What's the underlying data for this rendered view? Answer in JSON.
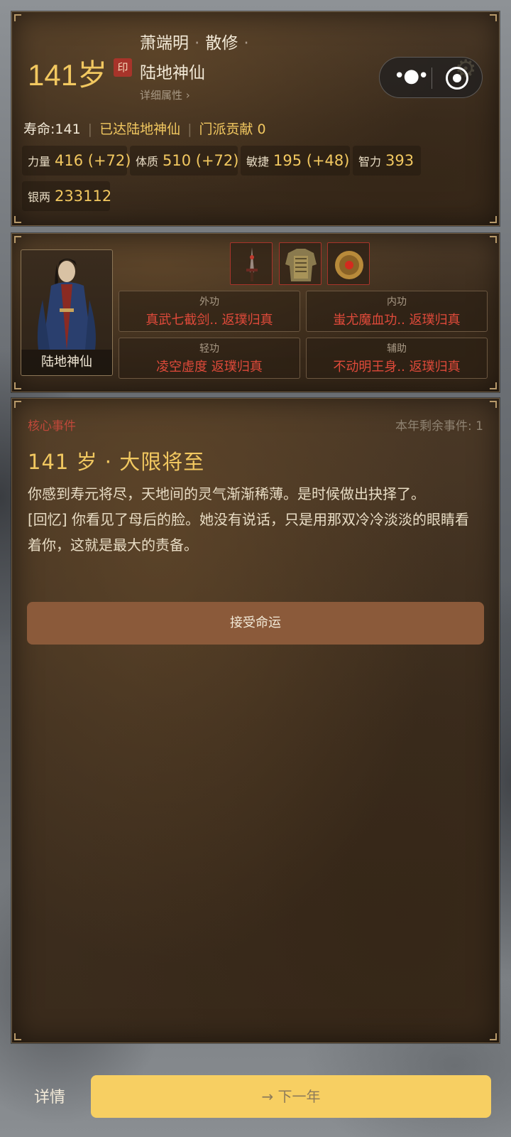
{
  "header": {
    "age": "141岁",
    "seal": "印",
    "name": "萧端明",
    "sect": "散修",
    "realm": "陆地神仙",
    "detail_link": "详细属性 ›"
  },
  "status": {
    "lifespan": "寿命:141",
    "achieved": "已达陆地神仙",
    "contribution": "门派贡献 0"
  },
  "stats": [
    {
      "label": "力量",
      "value": "416 (+72)"
    },
    {
      "label": "体质",
      "value": "510 (+72)"
    },
    {
      "label": "敏捷",
      "value": "195 (+48)"
    },
    {
      "label": "智力",
      "value": "393"
    },
    {
      "label": "银两",
      "value": "233112"
    }
  ],
  "character": {
    "portrait_label": "陆地神仙",
    "equipment": [
      "sword-icon",
      "armor-icon",
      "amulet-icon"
    ]
  },
  "skills": [
    {
      "category": "外功",
      "name": "真武七截剑.. 返璞归真"
    },
    {
      "category": "内功",
      "name": "蚩尤魔血功.. 返璞归真"
    },
    {
      "category": "轻功",
      "name": "凌空虚度 返璞归真"
    },
    {
      "category": "辅助",
      "name": "不动明王身.. 返璞归真"
    }
  ],
  "event": {
    "core_label": "核心事件",
    "remaining": "本年剩余事件: 1",
    "title": "141 岁 · 大限将至",
    "text1": "你感到寿元将尽，天地间的灵气渐渐稀薄。是时候做出抉择了。",
    "text2": "[回忆] 你看见了母后的脸。她没有说话，只是用那双冷冷淡淡的眼睛看着你，这就是最大的责备。",
    "accept_label": "接受命运"
  },
  "footer": {
    "detail_label": "详情",
    "next_label": "→ 下一年"
  },
  "colors": {
    "gold": "#f2c860",
    "red": "#e04a3a",
    "button_brown": "#8b5a3a",
    "next_yellow": "#f7cf62"
  }
}
